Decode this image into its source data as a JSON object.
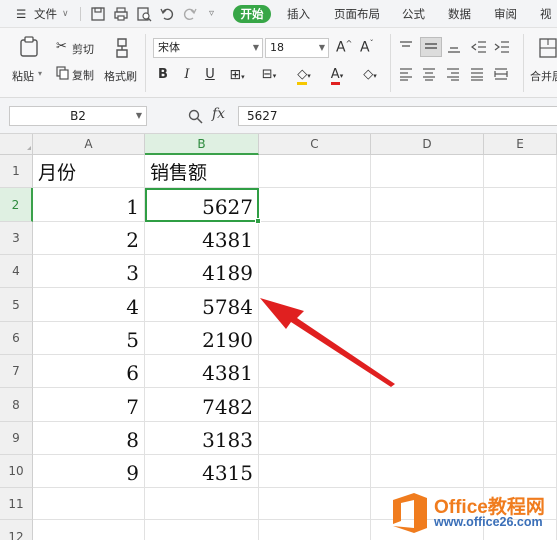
{
  "menu": {
    "file_label": "文件",
    "tabs": [
      "开始",
      "插入",
      "页面布局",
      "公式",
      "数据",
      "审阅",
      "视"
    ]
  },
  "ribbon": {
    "paste": "粘贴",
    "cut": "剪切",
    "copy": "复制",
    "format_painter": "格式刷",
    "font_name": "宋体",
    "font_size": "18",
    "bold": "B",
    "italic": "I",
    "underline": "U",
    "merge_center": "合并居"
  },
  "formula_bar": {
    "name_box": "B2",
    "fx_label": "fx",
    "value": "5627"
  },
  "sheet": {
    "columns": [
      "A",
      "B",
      "C",
      "D",
      "E"
    ],
    "selected_column": "B",
    "selected_row": "2",
    "rows": [
      {
        "n": "1",
        "a": "月份",
        "b": "销售额"
      },
      {
        "n": "2",
        "a": "1",
        "b": "5627"
      },
      {
        "n": "3",
        "a": "2",
        "b": "4381"
      },
      {
        "n": "4",
        "a": "3",
        "b": "4189"
      },
      {
        "n": "5",
        "a": "4",
        "b": "5784"
      },
      {
        "n": "6",
        "a": "5",
        "b": "2190"
      },
      {
        "n": "7",
        "a": "6",
        "b": "4381"
      },
      {
        "n": "8",
        "a": "7",
        "b": "7482"
      },
      {
        "n": "9",
        "a": "8",
        "b": "3183"
      },
      {
        "n": "10",
        "a": "9",
        "b": "4315"
      },
      {
        "n": "11",
        "a": "",
        "b": ""
      },
      {
        "n": "12",
        "a": "",
        "b": ""
      }
    ]
  },
  "annotation": {
    "arrow_color": "#e02020"
  },
  "watermark": {
    "title": "Office教程网",
    "url": "www.office26.com"
  },
  "colors": {
    "accent": "#37a647",
    "selection": "#2f9e44"
  }
}
